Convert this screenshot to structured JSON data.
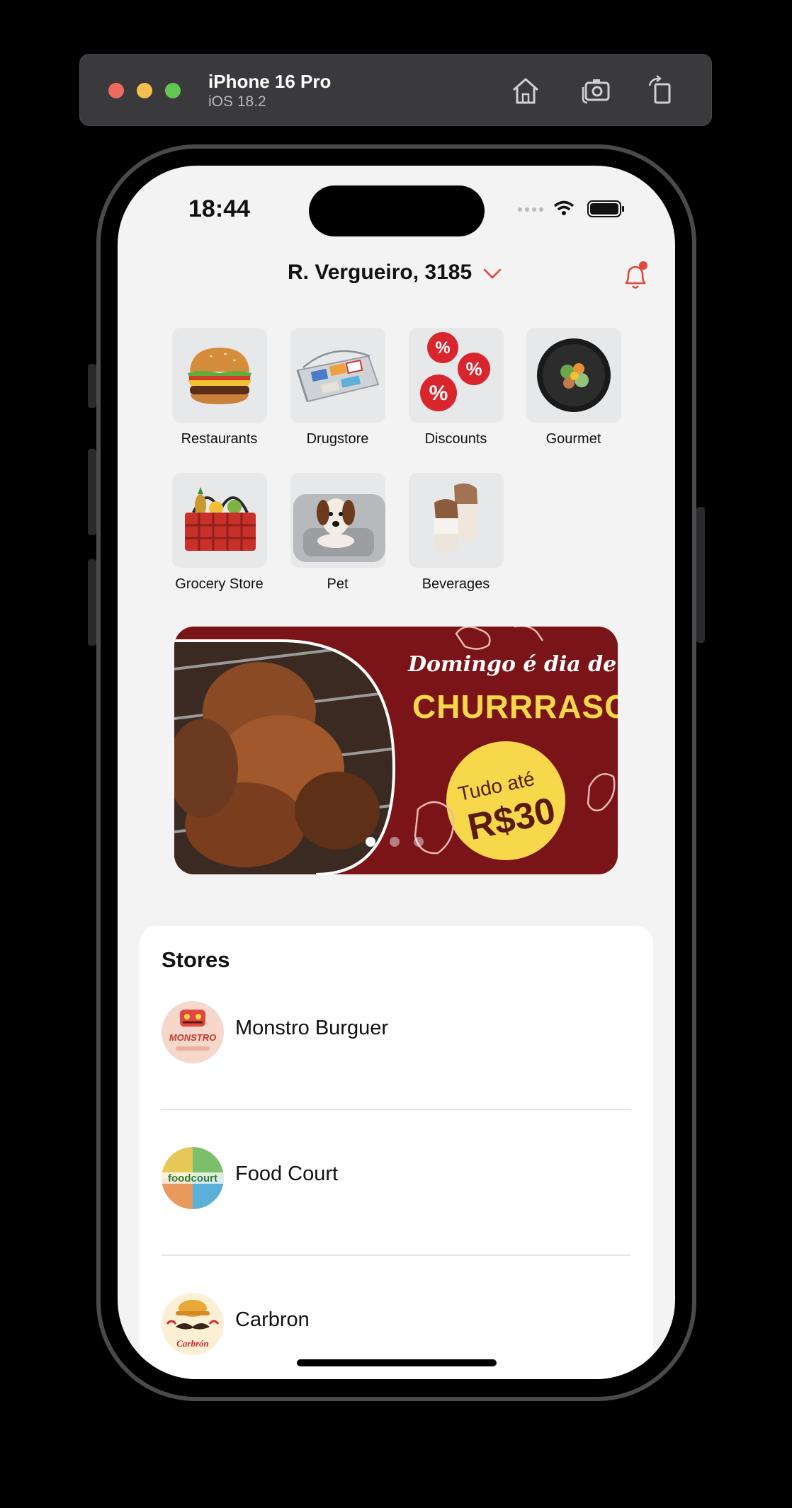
{
  "simulator": {
    "device_name": "iPhone 16 Pro",
    "os_version": "iOS 18.2",
    "buttons": [
      "home-icon",
      "screenshot-icon",
      "rotate-icon"
    ]
  },
  "status_bar": {
    "time": "18:44"
  },
  "header": {
    "address": "R. Vergueiro, 3185"
  },
  "categories": [
    {
      "label": "Restaurants",
      "icon": "burger"
    },
    {
      "label": "Drugstore",
      "icon": "medicine-basket"
    },
    {
      "label": "Discounts",
      "icon": "percent-balloons"
    },
    {
      "label": "Gourmet",
      "icon": "gourmet-plate"
    },
    {
      "label": "Grocery Store",
      "icon": "grocery-basket"
    },
    {
      "label": "Pet",
      "icon": "dog-bed"
    },
    {
      "label": "Beverages",
      "icon": "coffee-cups"
    }
  ],
  "banner": {
    "line1": "Domingo é dia de",
    "line2": "CHURRRASCO",
    "badge_line1": "Tudo até",
    "badge_line2": "R$30",
    "pages": 3,
    "active_page": 1
  },
  "stores": {
    "title": "Stores",
    "items": [
      {
        "name": "Monstro Burguer",
        "logo_text": "MONSTRO"
      },
      {
        "name": "Food Court",
        "logo_text": "foodcourt"
      },
      {
        "name": "Carbron",
        "logo_text": "Carbrón"
      }
    ]
  },
  "colors": {
    "accent": "#e0483e",
    "screen_bg": "#f3f3f4",
    "banner_bg": "#7a1418",
    "banner_yellow": "#f7d84a"
  }
}
